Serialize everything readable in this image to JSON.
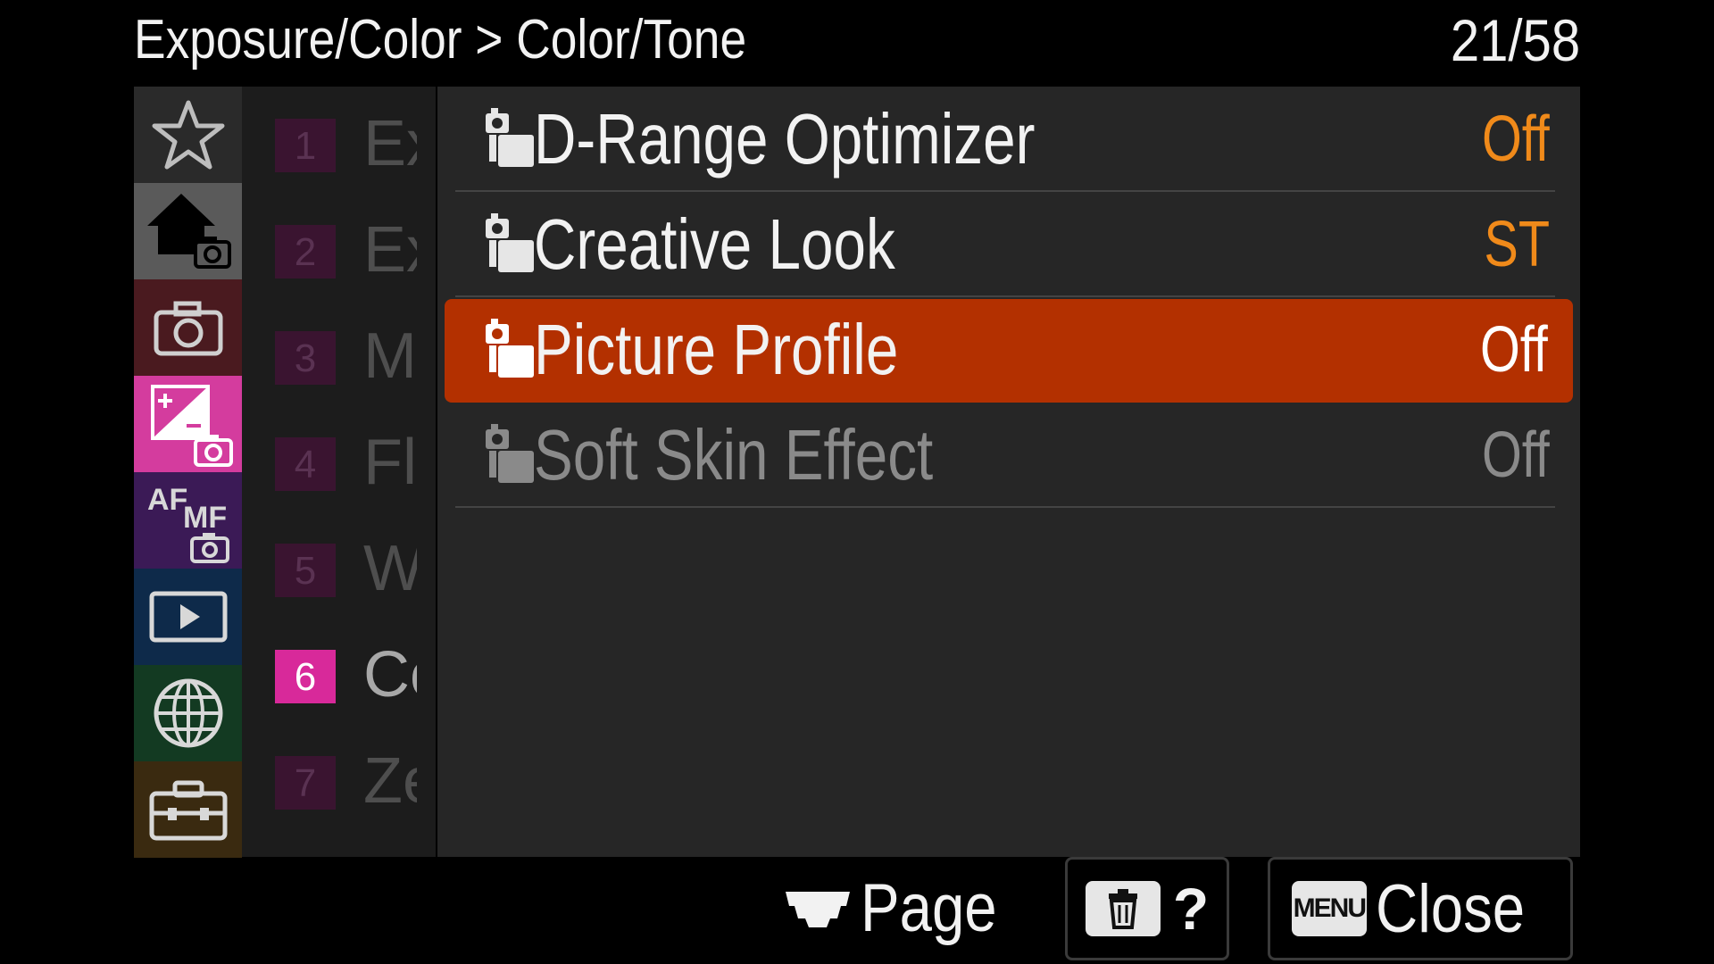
{
  "header": {
    "title": "Exposure/Color > Color/Tone",
    "page_counter": "21/58"
  },
  "categories": [
    {
      "name": "My Menu",
      "icon": "star-icon",
      "color": "#2a2a2a"
    },
    {
      "name": "Main",
      "icon": "home-camera-icon",
      "color": "#5a5a5a"
    },
    {
      "name": "Shooting",
      "icon": "camera-icon",
      "color": "#4a1a1f"
    },
    {
      "name": "Exposure/Color",
      "icon": "exposure-camera-icon",
      "color": "#d43c9e",
      "selected": true
    },
    {
      "name": "Focus",
      "icon": "af-mf-camera-icon",
      "color": "#3b1a56"
    },
    {
      "name": "Playback",
      "icon": "play-icon",
      "color": "#0e2a4a"
    },
    {
      "name": "Network",
      "icon": "globe-icon",
      "color": "#133a22"
    },
    {
      "name": "Setup",
      "icon": "toolbox-icon",
      "color": "#3a2a10"
    }
  ],
  "submenu": [
    {
      "num": "1",
      "label": "Exposure"
    },
    {
      "num": "2",
      "label": "Exposure Comp."
    },
    {
      "num": "3",
      "label": "Metering"
    },
    {
      "num": "4",
      "label": "Flash"
    },
    {
      "num": "5",
      "label": "White Balance"
    },
    {
      "num": "6",
      "label": "Color/Tone",
      "active": true
    },
    {
      "num": "7",
      "label": "Zebra Display"
    }
  ],
  "items": [
    {
      "label": "D-Range Optimizer",
      "value": "Off",
      "state": "normal"
    },
    {
      "label": "Creative Look",
      "value": "ST",
      "state": "normal"
    },
    {
      "label": "Picture Profile",
      "value": "Off",
      "state": "selected"
    },
    {
      "label": "Soft Skin Effect",
      "value": "Off",
      "state": "disabled"
    }
  ],
  "footer": {
    "page_label": "Page",
    "help_label": "?",
    "menu_key": "MENU",
    "close_label": "Close"
  },
  "colors": {
    "selection": "#b33000",
    "value_accent": "#f08a1a",
    "submenu_active": "#d8299a"
  }
}
